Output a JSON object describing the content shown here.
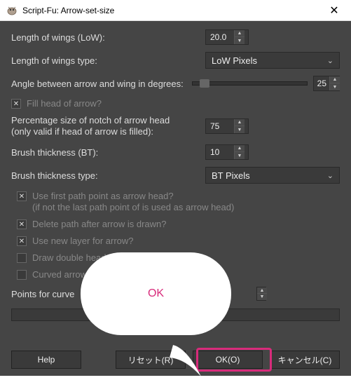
{
  "title": "Script-Fu: Arrow-set-size",
  "fields": {
    "length_of_wings": {
      "label": "Length of wings (LoW):",
      "value": "20.0"
    },
    "length_type": {
      "label": "Length of wings type:",
      "value": "LoW Pixels"
    },
    "angle": {
      "label": "Angle between arrow and wing in degrees:",
      "value": "25"
    },
    "fill_head": {
      "label": "Fill head of arrow?",
      "checked": true
    },
    "notch_pct": {
      "label": "Percentage size of notch of arrow head\n(only valid if head of arrow is filled):",
      "value": "75"
    },
    "brush_thick": {
      "label": "Brush thickness (BT):",
      "value": "10"
    },
    "brush_type": {
      "label": "Brush thickness type:",
      "value": "BT Pixels"
    },
    "use_first_path": {
      "label1": "Use first path point as arrow head?",
      "label2": "(if not the last path point of is used as arrow head)",
      "checked": true
    },
    "delete_path": {
      "label": "Delete path after arrow is drawn?",
      "checked": true
    },
    "new_layer": {
      "label": "Use new layer for arrow?",
      "checked": true
    },
    "double_head": {
      "label": "Draw double headed arrow?",
      "checked": false
    },
    "curved": {
      "label": "Curved arrow w",
      "checked": false
    },
    "points_curve": {
      "label": "Points for curve",
      "value": ""
    }
  },
  "buttons": {
    "help": "Help",
    "reset": "リセット(R)",
    "ok": "OK(O)",
    "cancel": "キャンセル(C)"
  },
  "bubble": {
    "text": "OK"
  }
}
